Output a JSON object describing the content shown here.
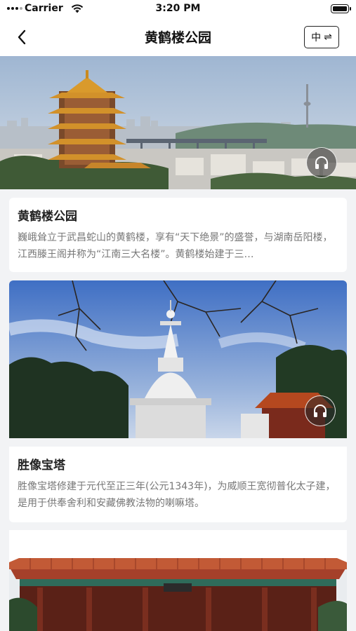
{
  "status_bar": {
    "carrier": "Carrier",
    "time": "3:20 PM"
  },
  "nav": {
    "title": "黄鹤楼公园",
    "lang_label": "中",
    "lang_switch_glyph": "⇌"
  },
  "colors": {
    "accent": "#222222",
    "card_bg": "#ffffff",
    "page_bg": "#f2f3f5",
    "desc_text": "#777777"
  },
  "spots": [
    {
      "name": "黄鹤楼公园",
      "description": "巍峨耸立于武昌蛇山的黄鹤楼，享有“天下绝景”的盛誉，与湖南岳阳楼，江西滕王阁并称为“江南三大名楼”。黄鹤楼始建于三…",
      "icon": "headphones-icon"
    },
    {
      "name": "胜像宝塔",
      "description": "胜像宝塔修建于元代至正三年(公元1343年)，为威顺王宽彻普化太子建，是用于供奉舍利和安藏佛教法物的喇嘛塔。",
      "icon": "headphones-icon"
    },
    {
      "name": "",
      "description": ""
    }
  ]
}
